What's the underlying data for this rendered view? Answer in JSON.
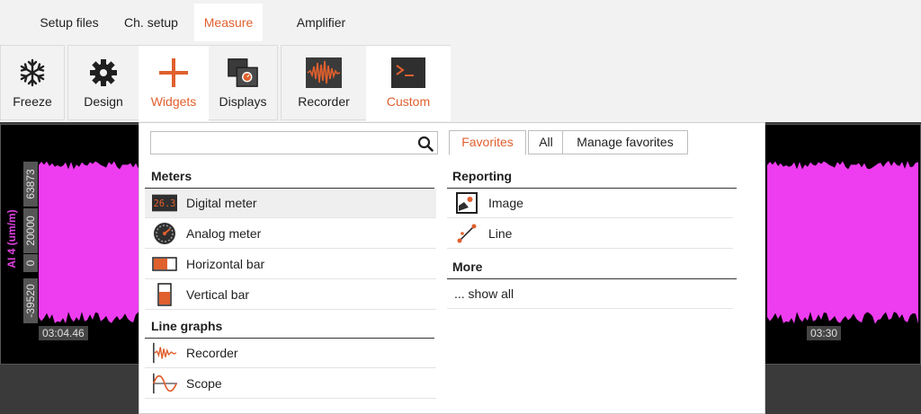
{
  "menu_tabs": [
    {
      "label": "Setup files",
      "active": false
    },
    {
      "label": "Ch. setup",
      "active": false
    },
    {
      "label": "Measure",
      "active": true
    },
    {
      "label": "Amplifier",
      "active": false
    }
  ],
  "ribbon": {
    "freeze": {
      "label": "Freeze",
      "icon": "snowflake-icon"
    },
    "design": {
      "label": "Design",
      "icon": "gear-icon"
    },
    "widgets": {
      "label": "Widgets",
      "icon": "plus-icon"
    },
    "displays": {
      "label": "Displays",
      "icon": "displays-icon"
    },
    "recorder": {
      "label": "Recorder",
      "icon": "recorder-icon"
    },
    "custom": {
      "label": "Custom",
      "icon": "terminal-icon"
    }
  },
  "colors": {
    "accent": "#e0602e",
    "signal": "#ee3cf0"
  },
  "graph": {
    "channel_label": "AI 4 (um/m)",
    "y_ticks": [
      "63873",
      "20000",
      "0",
      "-39520"
    ],
    "x_ticks": [
      "03:04.46",
      "03:30"
    ]
  },
  "dropdown": {
    "search": {
      "value": "",
      "placeholder": ""
    },
    "filter_tabs": [
      "Favorites",
      "All",
      "Manage favorites"
    ],
    "meters": {
      "title": "Meters",
      "items": [
        {
          "label": "Digital meter",
          "icon": "digital-meter-icon",
          "display": "26.3"
        },
        {
          "label": "Analog meter",
          "icon": "analog-meter-icon"
        },
        {
          "label": "Horizontal bar",
          "icon": "horizontal-bar-icon"
        },
        {
          "label": "Vertical bar",
          "icon": "vertical-bar-icon"
        }
      ]
    },
    "line_graphs": {
      "title": "Line graphs",
      "items": [
        {
          "label": "Recorder",
          "icon": "recorder-graph-icon"
        },
        {
          "label": "Scope",
          "icon": "scope-icon"
        }
      ]
    },
    "reporting": {
      "title": "Reporting",
      "items": [
        {
          "label": "Image",
          "icon": "image-icon"
        },
        {
          "label": "Line",
          "icon": "line-icon"
        }
      ]
    },
    "more": {
      "title": "More",
      "items": [
        {
          "label": "... show all"
        }
      ]
    }
  }
}
